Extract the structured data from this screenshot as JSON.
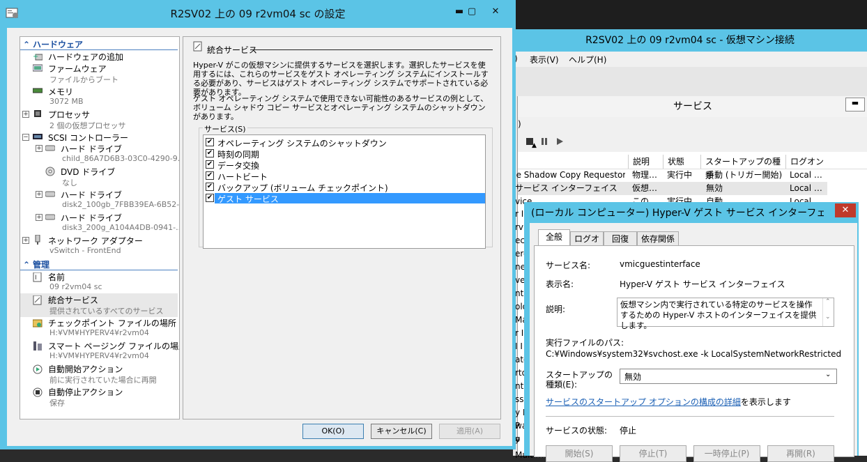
{
  "vm_conn": {
    "title": "R2SV02 上の 09 r2vm04 sc  - 仮想マシン接続",
    "menu_frag": ")",
    "menu_view": "表示(V)",
    "menu_help": "ヘルプ(H)"
  },
  "services": {
    "title": "サービス",
    "min_label": "▬",
    "menu_frag": ")",
    "col_sort": "▲",
    "columns": [
      "説明",
      "状態",
      "スタートアップの種類",
      "ログオン"
    ],
    "rows": [
      {
        "name": "ne Shadow Copy Requestor",
        "desc": "物理…",
        "state": "実行中",
        "startup": "手動 (トリガー開始)",
        "logon": "Local …"
      },
      {
        "name": "サービス インターフェイス",
        "desc": "仮想…",
        "state": "",
        "startup": "無効",
        "logon": "Local …"
      },
      {
        "name": "vice",
        "desc": "この…",
        "state": "実行中",
        "startup": "自動",
        "logon": "Local …"
      }
    ],
    "left_fragments": [
      "r I",
      "rvi",
      "ect",
      "ere",
      "ner",
      "ve",
      "ntr",
      "olo",
      "Ma",
      "r I",
      "I I",
      "ato",
      "rto",
      "nti",
      "ssi",
      "y P",
      "P",
      "y",
      "wa",
      "o",
      "Multimedia Class"
    ]
  },
  "settings": {
    "title": "R2SV02 上の 09 r2vm04 sc の設定",
    "btn_min": "▬",
    "btn_max": "▢",
    "btn_close": "✕",
    "tree": {
      "hardware_cat": "ハードウェア",
      "mgmt_cat": "管理",
      "items": [
        {
          "label": "ハードウェアの追加",
          "sub": ""
        },
        {
          "label": "ファームウェア",
          "sub": "ファイルからブート"
        },
        {
          "label": "メモリ",
          "sub": "3072 MB"
        },
        {
          "label": "プロセッサ",
          "sub": "2 個の仮想プロセッサ"
        },
        {
          "label": "SCSI コントローラー",
          "sub": ""
        },
        {
          "label": "ハード ドライブ",
          "sub": "child_86A7D6B3-03C0-4290-9..."
        },
        {
          "label": "DVD ドライブ",
          "sub": "なし"
        },
        {
          "label": "ハード ドライブ",
          "sub": "disk2_100gb_7FBB39EA-6B52-..."
        },
        {
          "label": "ハード ドライブ",
          "sub": "disk3_200g_A104A4DB-0941-..."
        },
        {
          "label": "ネットワーク アダプター",
          "sub": "vSwitch - FrontEnd"
        }
      ],
      "mgmt_items": [
        {
          "label": "名前",
          "sub": "09 r2vm04 sc"
        },
        {
          "label": "統合サービス",
          "sub": "提供されているすべてのサービス"
        },
        {
          "label": "チェックポイント ファイルの場所",
          "sub": "H:¥VM¥HYPERV4¥r2vm04"
        },
        {
          "label": "スマート ページング ファイルの場所",
          "sub": "H:¥VM¥HYPERV4¥r2vm04"
        },
        {
          "label": "自動開始アクション",
          "sub": "前に実行されていた場合に再開"
        },
        {
          "label": "自動停止アクション",
          "sub": "保存"
        }
      ]
    },
    "panel": {
      "heading": "統合サービス",
      "p1": "Hyper-V がこの仮想マシンに提供するサービスを選択します。選択したサービスを使用するには、これらのサービスをゲスト オペレーティング システムにインストールする必要があり、サービスはゲスト オペレーティング システムでサポートされている必要があります。",
      "p2": "ゲスト オペレーティング システムで使用できない可能性のあるサービスの例として、ボリューム シャドウ コピー サービスとオペレーティング システムのシャットダウンがあります。",
      "group_label": "サービス(S)",
      "services": [
        {
          "label": "オペレーティング システムのシャットダウン",
          "checked": "✔"
        },
        {
          "label": "時刻の同期",
          "checked": "✔"
        },
        {
          "label": "データ交換",
          "checked": "✔"
        },
        {
          "label": "ハートビート",
          "checked": "✔"
        },
        {
          "label": "バックアップ (ボリューム チェックポイント)",
          "checked": "✔"
        },
        {
          "label": "ゲスト サービス",
          "checked": "✔"
        }
      ]
    },
    "buttons": {
      "ok": "OK(O)",
      "cancel": "キャンセル(C)",
      "apply": "適用(A)"
    }
  },
  "props": {
    "title": "(ローカル コンピューター) Hyper-V ゲスト サービス インターフェイス のプ...",
    "close": "✕",
    "tabs": [
      "全般",
      "ログオン",
      "回復",
      "依存関係"
    ],
    "service_name_label": "サービス名:",
    "service_name": "vmicguestinterface",
    "display_name_label": "表示名:",
    "display_name": "Hyper-V ゲスト サービス インターフェイス",
    "desc_label": "説明:",
    "desc": "仮想マシン内で実行されている特定のサービスを操作するための Hyper-V ホストのインターフェイスを提供します。",
    "path_label": "実行ファイルのパス:",
    "path": "C:¥Windows¥system32¥svchost.exe -k LocalSystemNetworkRestricted",
    "startup_label1": "スタートアップの",
    "startup_label2": "種類(E):",
    "startup_value": "無効",
    "link_text": "サービスのスタートアップ オプションの構成の詳細",
    "link_suffix": "を表示します",
    "status_label": "サービスの状態:",
    "status_value": "停止",
    "buttons": [
      "開始(S)",
      "停止(T)",
      "一時停止(P)",
      "再開(R)"
    ]
  }
}
